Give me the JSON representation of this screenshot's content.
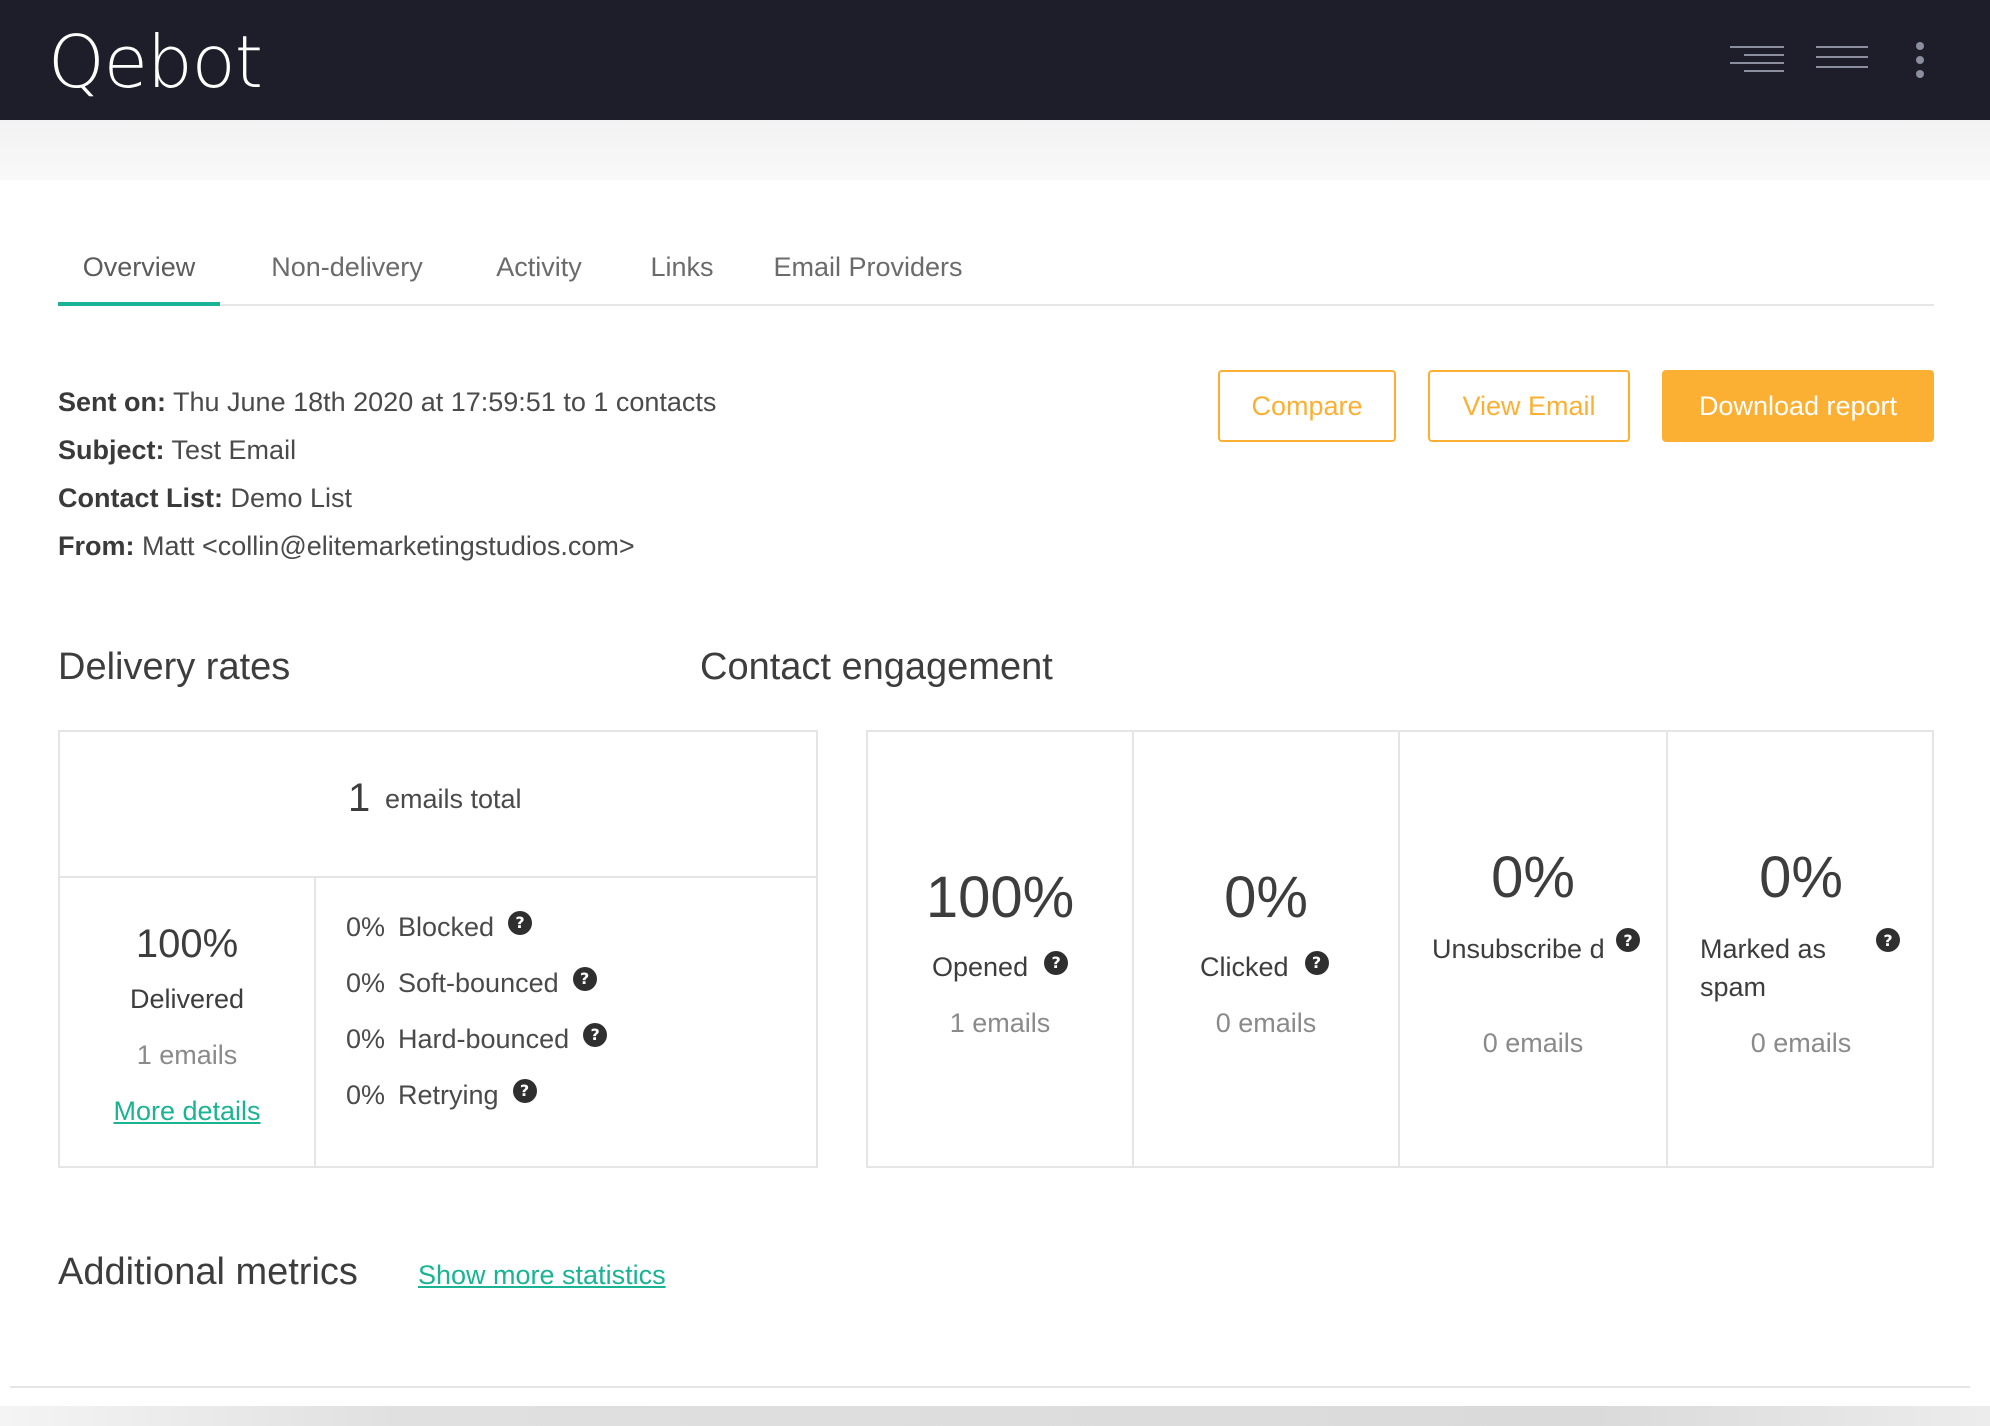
{
  "app": {
    "logo": "Qebot"
  },
  "tabs": [
    {
      "label": "Overview"
    },
    {
      "label": "Non-delivery"
    },
    {
      "label": "Activity"
    },
    {
      "label": "Links"
    },
    {
      "label": "Email Providers"
    }
  ],
  "info": {
    "sent_label": "Sent on:",
    "sent_value": "Thu June 18th 2020 at 17:59:51 to 1 contacts",
    "subject_label": "Subject:",
    "subject_value": "Test Email",
    "list_label": "Contact List:",
    "list_value": "Demo List",
    "from_label": "From:",
    "from_value": "Matt <collin@elitemarketingstudios.com>"
  },
  "actions": {
    "compare": "Compare",
    "view_email": "View Email",
    "download": "Download report"
  },
  "delivery": {
    "title": "Delivery rates",
    "total_value": "1",
    "total_label": "emails total",
    "delivered_pct": "100%",
    "delivered_label": "Delivered",
    "delivered_count": "1 emails",
    "more_details": "More details",
    "breakdown": [
      {
        "pct": "0%",
        "label": "Blocked"
      },
      {
        "pct": "0%",
        "label": "Soft-bounced"
      },
      {
        "pct": "0%",
        "label": "Hard-bounced"
      },
      {
        "pct": "0%",
        "label": "Retrying"
      }
    ]
  },
  "engagement": {
    "title": "Contact engagement",
    "metrics": [
      {
        "pct": "100%",
        "label": "Opened",
        "count": "1 emails"
      },
      {
        "pct": "0%",
        "label": "Clicked",
        "count": "0 emails"
      },
      {
        "pct": "0%",
        "label": "Unsubscribe d",
        "count": "0 emails"
      },
      {
        "pct": "0%",
        "label": "Marked as spam",
        "count": "0 emails"
      }
    ]
  },
  "additional": {
    "title": "Additional metrics",
    "link": "Show more statistics"
  },
  "colors": {
    "topbar": "#1e1e2b",
    "accent_teal": "#1ab394",
    "accent_orange": "#fbb034"
  },
  "icons": {
    "hamburger": "hamburger-icon",
    "kebab": "kebab-menu-icon",
    "help": "question-circle-icon",
    "help_glyph": "?"
  }
}
